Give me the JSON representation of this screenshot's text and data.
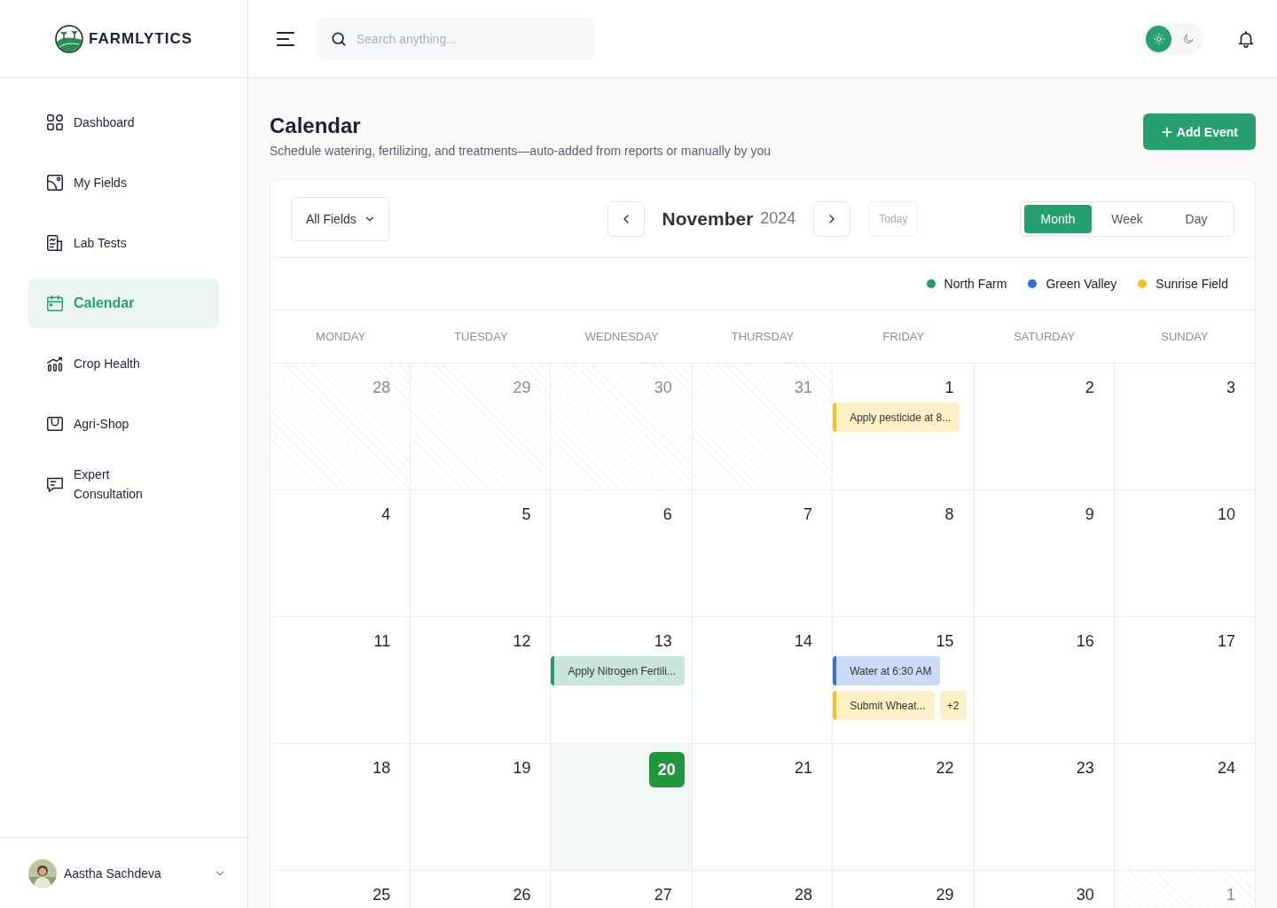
{
  "brand": {
    "name": "FARMLYTICS"
  },
  "search": {
    "placeholder": "Search anything..."
  },
  "theme": {
    "options": [
      {
        "kind": "sun",
        "selected": true
      },
      {
        "kind": "moon",
        "selected": false
      }
    ]
  },
  "sidebar": {
    "items": [
      {
        "label": "Dashboard",
        "kind": "grid",
        "selected": false
      },
      {
        "label": "My Fields",
        "kind": "field",
        "selected": false
      },
      {
        "label": "Lab Tests",
        "kind": "report",
        "selected": false
      },
      {
        "label": "Calendar",
        "kind": "calendar",
        "selected": true
      },
      {
        "label": "Crop Health",
        "kind": "chart",
        "selected": false
      },
      {
        "label": "Agri-Shop",
        "kind": "bag",
        "selected": false
      },
      {
        "label": "Expert Consultation",
        "kind": "chat",
        "selected": false
      }
    ],
    "user": {
      "name": "Aastha Sachdeva"
    }
  },
  "page": {
    "title": "Calendar",
    "subtitle": "Schedule watering, fertilizing, and treatments—auto-added from reports or manually by you",
    "add_button": "Add Event"
  },
  "toolbar": {
    "filter": "All Fields",
    "month": "November",
    "year": "2024",
    "today": "Today",
    "views": [
      {
        "label": "Month",
        "selected": true
      },
      {
        "label": "Week",
        "selected": false
      },
      {
        "label": "Day",
        "selected": false
      }
    ]
  },
  "legend": [
    {
      "label": "North Farm",
      "color": "#239b6e"
    },
    {
      "label": "Green Valley",
      "color": "#2f6fe4"
    },
    {
      "label": "Sunrise Field",
      "color": "#f6c21c"
    }
  ],
  "weekdays": [
    "MONDAY",
    "TUESDAY",
    "WEDNESDAY",
    "THURSDAY",
    "FRIDAY",
    "SATURDAY",
    "SUNDAY"
  ],
  "weeks": [
    [
      {
        "day": "28",
        "outside": true,
        "today": false
      },
      {
        "day": "29",
        "outside": true,
        "today": false
      },
      {
        "day": "30",
        "outside": true,
        "today": false
      },
      {
        "day": "31",
        "outside": true,
        "today": false
      },
      {
        "day": "1",
        "outside": false,
        "today": false,
        "events": [
          {
            "text": "Apply pesticide at 8...",
            "color": "#f6c21c"
          }
        ]
      },
      {
        "day": "2",
        "outside": false,
        "today": false
      },
      {
        "day": "3",
        "outside": false,
        "today": false
      }
    ],
    [
      {
        "day": "4",
        "outside": false,
        "today": false
      },
      {
        "day": "5",
        "outside": false,
        "today": false
      },
      {
        "day": "6",
        "outside": false,
        "today": false
      },
      {
        "day": "7",
        "outside": false,
        "today": false
      },
      {
        "day": "8",
        "outside": false,
        "today": false
      },
      {
        "day": "9",
        "outside": false,
        "today": false
      },
      {
        "day": "10",
        "outside": false,
        "today": false
      }
    ],
    [
      {
        "day": "11",
        "outside": false,
        "today": false
      },
      {
        "day": "12",
        "outside": false,
        "today": false
      },
      {
        "day": "13",
        "outside": false,
        "today": false,
        "events": [
          {
            "text": "Apply Nitrogen Fertili...",
            "color": "#239b6e"
          }
        ]
      },
      {
        "day": "14",
        "outside": false,
        "today": false
      },
      {
        "day": "15",
        "outside": false,
        "today": false,
        "events": [
          {
            "text": "Water at 6:30 AM",
            "color": "#2f6fe4"
          },
          {
            "text": "Submit Wheat...",
            "color": "#f6c21c",
            "more": "+2"
          }
        ]
      },
      {
        "day": "16",
        "outside": false,
        "today": false
      },
      {
        "day": "17",
        "outside": false,
        "today": false
      }
    ],
    [
      {
        "day": "18",
        "outside": false,
        "today": false
      },
      {
        "day": "19",
        "outside": false,
        "today": false
      },
      {
        "day": "20",
        "outside": false,
        "today": true
      },
      {
        "day": "21",
        "outside": false,
        "today": false
      },
      {
        "day": "22",
        "outside": false,
        "today": false
      },
      {
        "day": "23",
        "outside": false,
        "today": false
      },
      {
        "day": "24",
        "outside": false,
        "today": false
      }
    ],
    [
      {
        "day": "25",
        "outside": false,
        "today": false
      },
      {
        "day": "26",
        "outside": false,
        "today": false
      },
      {
        "day": "27",
        "outside": false,
        "today": false
      },
      {
        "day": "28",
        "outside": false,
        "today": false
      },
      {
        "day": "29",
        "outside": false,
        "today": false
      },
      {
        "day": "30",
        "outside": false,
        "today": false
      },
      {
        "day": "1",
        "outside": true,
        "today": false
      }
    ]
  ]
}
